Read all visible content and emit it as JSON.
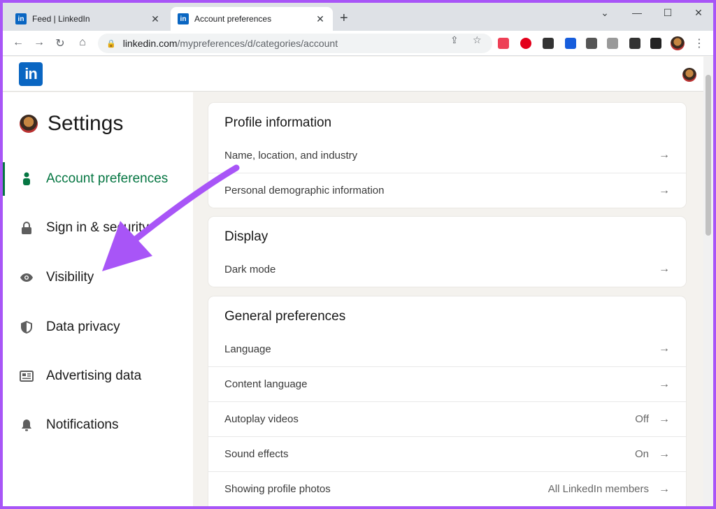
{
  "browser": {
    "tabs": [
      {
        "title": "Feed | LinkedIn",
        "favicon": "in"
      },
      {
        "title": "Account preferences",
        "favicon": "in"
      }
    ],
    "url_domain": "linkedin.com",
    "url_path": "/mypreferences/d/categories/account"
  },
  "header": {
    "logo": "in"
  },
  "sidebar": {
    "title": "Settings",
    "items": [
      {
        "label": "Account preferences",
        "icon": "person-icon"
      },
      {
        "label": "Sign in & security",
        "icon": "lock-icon"
      },
      {
        "label": "Visibility",
        "icon": "eye-icon"
      },
      {
        "label": "Data privacy",
        "icon": "shield-icon"
      },
      {
        "label": "Advertising data",
        "icon": "newspaper-icon"
      },
      {
        "label": "Notifications",
        "icon": "bell-icon"
      }
    ]
  },
  "sections": {
    "profile": {
      "title": "Profile information",
      "rows": [
        {
          "label": "Name, location, and industry"
        },
        {
          "label": "Personal demographic information"
        }
      ]
    },
    "display": {
      "title": "Display",
      "rows": [
        {
          "label": "Dark mode"
        }
      ]
    },
    "general": {
      "title": "General preferences",
      "rows": [
        {
          "label": "Language",
          "value": ""
        },
        {
          "label": "Content language",
          "value": ""
        },
        {
          "label": "Autoplay videos",
          "value": "Off"
        },
        {
          "label": "Sound effects",
          "value": "On"
        },
        {
          "label": "Showing profile photos",
          "value": "All LinkedIn members"
        }
      ]
    }
  },
  "colors": {
    "accent": "#057642",
    "brand": "#0a66c2",
    "annotation": "#a855f7"
  }
}
